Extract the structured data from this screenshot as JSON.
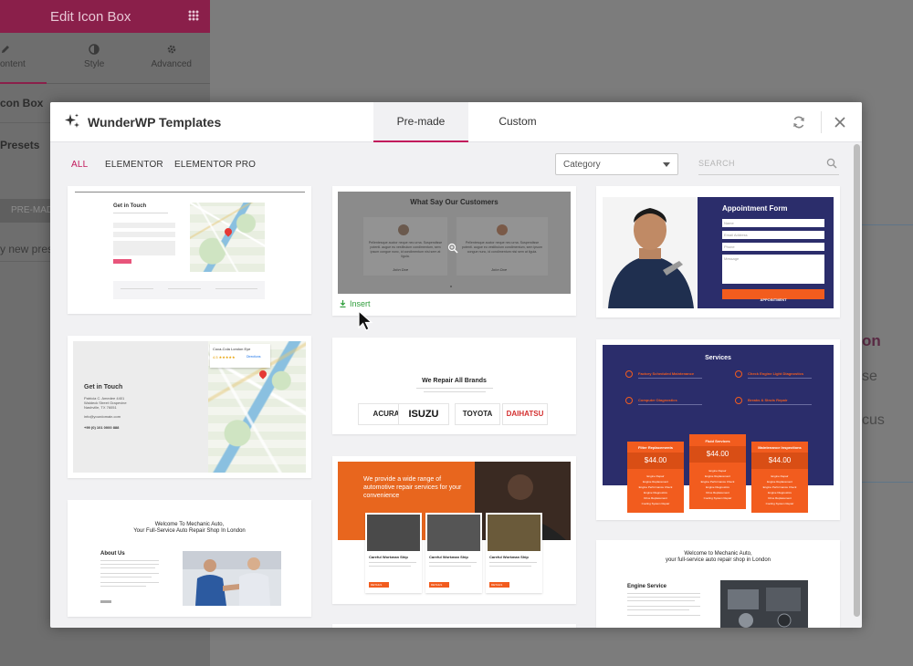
{
  "editor": {
    "panel_title": "Edit Icon Box",
    "tabs": [
      "ontent",
      "Style",
      "Advanced"
    ],
    "section_1": "con Box",
    "section_2": "Presets",
    "btn_premade": "PRE-MAD",
    "new_preset": "y new pres",
    "bg_word_on": "on",
    "bg_word_se": "se",
    "bg_word_cus": "cus"
  },
  "modal": {
    "title": "WunderWP Templates",
    "tabs": [
      "Pre-made",
      "Custom"
    ],
    "active_tab": "Pre-made",
    "filters": [
      "ALL",
      "ELEMENTOR",
      "ELEMENTOR PRO"
    ],
    "active_filter": "ALL",
    "category_select": "Category",
    "search_placeholder": "SEARCH",
    "insert_label": "Insert"
  },
  "templates": {
    "contact1": {
      "heading": "Get in Touch"
    },
    "customers": {
      "heading": "What Say Our Customers",
      "quote": "Pellentesque auctor neque nec urna. Suspendisse potenti. augue eu vestibulum condimentum, sem ipsum congue nunc, id condimentum nisi sem at ligula.",
      "names": [
        "John Doe",
        "John Doe"
      ]
    },
    "appointment": {
      "heading": "Appointment Form",
      "fields": [
        "Name",
        "Email Address",
        "Phone",
        "Message"
      ],
      "button": "APPOINTMENT"
    },
    "contact2": {
      "heading": "Get in Touch",
      "address_1": "Patricia C. Amedee 4401",
      "address_2": "Waldeck Street Grapevine",
      "address_3": "Nashville, TX 76051",
      "email": "info@yourdomain.com",
      "phone": "+99 (0) 101 0000 888",
      "map_place": "Coca-Cola London Eye",
      "map_rating": "4.5 ★★★★★",
      "map_directions": "Directions"
    },
    "brands": {
      "heading": "We Repair All Brands",
      "items": [
        "ACURA",
        "ISUZU",
        "TOYOTA",
        "DAIHATSU"
      ]
    },
    "services": {
      "heading": "Services",
      "items": [
        "Factory Scheduled Maintenance",
        "Check Engine Light Diagnostics",
        "Computer Diagnostics",
        "Breaks & Struts Repair"
      ],
      "plans": [
        {
          "name": "Filter Replacements",
          "price": "$44.00"
        },
        {
          "name": "Fluid Services",
          "price": "$44.00"
        },
        {
          "name": "Maintenance Inspections",
          "price": "$44.00"
        }
      ],
      "plan_lines": [
        "Engine Repair",
        "Engine Replacement",
        "Engine Performance Check",
        "Engine Diagnostics",
        "Drive Replacement",
        "Cooling System Repair"
      ]
    },
    "welcome": {
      "line1": "Welcome To Mechanic Auto,",
      "line2": "Your Full-Service Auto Repair Shop In London",
      "about": "About Us"
    },
    "wide_range": {
      "heading_1": "We provide a wide range of",
      "heading_2": "automotive repair services for your",
      "heading_3": "convenience",
      "cards": [
        "Careful Workman Ship",
        "Careful Workman Ship",
        "Careful Workman Ship"
      ],
      "button": "DETAILS"
    },
    "engine": {
      "line1": "Welcome to Mechanic Auto,",
      "line2": "your full-service auto repair shop in London",
      "heading": "Engine Service"
    }
  },
  "colors": {
    "accent": "#c2185b",
    "insert_green": "#2e9d3a",
    "navy": "#2b2d6b",
    "orange": "#f25c1e"
  }
}
